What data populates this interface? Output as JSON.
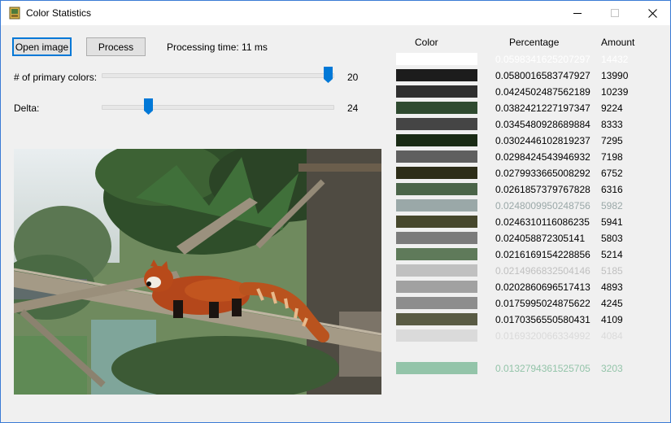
{
  "window": {
    "title": "Color Statistics"
  },
  "controls": {
    "open_image": "Open image",
    "process": "Process",
    "processing_time": "Processing time: 11 ms",
    "primary_colors_label": "# of primary colors:",
    "primary_colors_value": "20",
    "primary_colors_fraction": 1.0,
    "delta_label": "Delta:",
    "delta_value": "24",
    "delta_fraction": 0.19
  },
  "icons": {
    "app": "picture-icon",
    "minimize": "minimize-icon",
    "maximize": "maximize-icon",
    "close": "close-icon",
    "slider": "slider-thumb-icon"
  },
  "table": {
    "headers": {
      "color": "Color",
      "percentage": "Percentage",
      "amount": "Amount"
    },
    "rows": [
      {
        "color": "#ffffff",
        "text_color": "#ffffff",
        "percentage": "0.0598341625207297",
        "amount": "14432"
      },
      {
        "color": "#1c1c1c",
        "text_color": "#000000",
        "percentage": "0.0580016583747927",
        "amount": "13990"
      },
      {
        "color": "#2f2f2f",
        "text_color": "#000000",
        "percentage": "0.0424502487562189",
        "amount": "10239"
      },
      {
        "color": "#2f4a30",
        "text_color": "#000000",
        "percentage": "0.0382421227197347",
        "amount": "9224"
      },
      {
        "color": "#454545",
        "text_color": "#000000",
        "percentage": "0.0345480928689884",
        "amount": "8333"
      },
      {
        "color": "#1a2b15",
        "text_color": "#000000",
        "percentage": "0.0302446102819237",
        "amount": "7295"
      },
      {
        "color": "#5f5f5f",
        "text_color": "#000000",
        "percentage": "0.0298424543946932",
        "amount": "7198"
      },
      {
        "color": "#2d2d18",
        "text_color": "#000000",
        "percentage": "0.0279933665008292",
        "amount": "6752"
      },
      {
        "color": "#4b6549",
        "text_color": "#000000",
        "percentage": "0.0261857379767828",
        "amount": "6316"
      },
      {
        "color": "#9aa8a8",
        "text_color": "#9aa8a8",
        "percentage": "0.0248009950248756",
        "amount": "5982"
      },
      {
        "color": "#46472c",
        "text_color": "#000000",
        "percentage": "0.0246310116086235",
        "amount": "5941"
      },
      {
        "color": "#7b7b7b",
        "text_color": "#000000",
        "percentage": "0.024058872305141",
        "amount": "5803"
      },
      {
        "color": "#5f7a5a",
        "text_color": "#000000",
        "percentage": "0.0216169154228856",
        "amount": "5214"
      },
      {
        "color": "#c0c0c0",
        "text_color": "#c0c0c0",
        "percentage": "0.0214966832504146",
        "amount": "5185"
      },
      {
        "color": "#a1a1a1",
        "text_color": "#000000",
        "percentage": "0.0202860696517413",
        "amount": "4893"
      },
      {
        "color": "#8d8d8d",
        "text_color": "#000000",
        "percentage": "0.0175995024875622",
        "amount": "4245"
      },
      {
        "color": "#595b44",
        "text_color": "#000000",
        "percentage": "0.0170356550580431",
        "amount": "4109"
      },
      {
        "color": "#dadada",
        "text_color": "#dadada",
        "percentage": "0.0169320066334992",
        "amount": "4084"
      },
      {
        "color": "#f0f0f0",
        "text_color": "#f0f0f0",
        "percentage": "",
        "amount": ""
      },
      {
        "color": "#93c4a9",
        "text_color": "#93c4a9",
        "percentage": "0.0132794361525705",
        "amount": "3203"
      }
    ]
  }
}
